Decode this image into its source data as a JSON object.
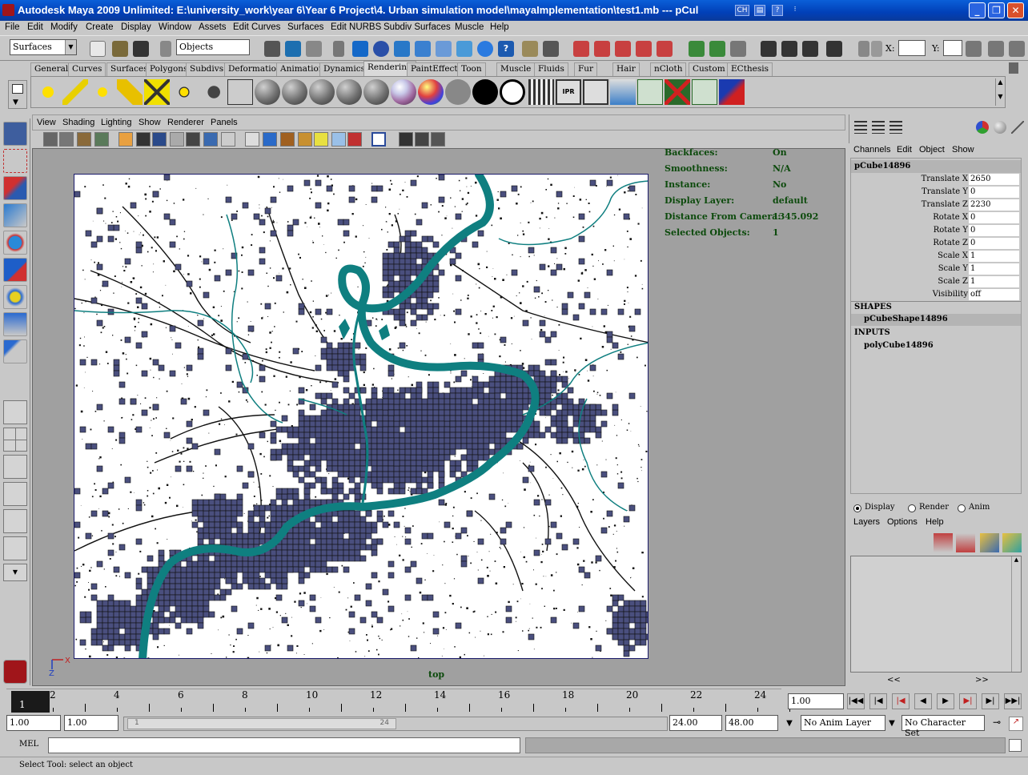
{
  "window": {
    "title": "Autodesk Maya 2009 Unlimited: E:\\university_work\\year 6\\Year 6 Project\\4. Urban simulation model\\mayaImplementation\\test1.mb  ---  pCul",
    "ch_badge": "CH"
  },
  "menubar": [
    "File",
    "Edit",
    "Modify",
    "Create",
    "Display",
    "Window",
    "Assets",
    "Edit Curves",
    "Surfaces",
    "Edit NURBS",
    "Subdiv Surfaces",
    "Muscle",
    "Help"
  ],
  "statusline": {
    "menuset": "Surfaces",
    "selection_mode": "Objects",
    "x_label": "X:",
    "y_label": "Y:"
  },
  "shelf_tabs": [
    "General",
    "Curves",
    "Surfaces",
    "Polygons",
    "Subdivs",
    "Deformation",
    "Animation",
    "Dynamics",
    "Rendering",
    "PaintEffects",
    "Toon",
    "Muscle",
    "Fluids",
    "Fur",
    "Hair",
    "nCloth",
    "Custom",
    "ECthesis"
  ],
  "active_shelf": "Rendering",
  "panel_menu": [
    "View",
    "Shading",
    "Lighting",
    "Show",
    "Renderer",
    "Panels"
  ],
  "hud": [
    {
      "label": "Backfaces:",
      "value": "On"
    },
    {
      "label": "Smoothness:",
      "value": "N/A"
    },
    {
      "label": "Instance:",
      "value": "No"
    },
    {
      "label": "Display Layer:",
      "value": "default"
    },
    {
      "label": "Distance From Camera:",
      "value": "1345.092"
    },
    {
      "label": "Selected Objects:",
      "value": "1"
    }
  ],
  "camera_name": "top",
  "axis": {
    "x": "X",
    "z": "Z"
  },
  "channel_box": {
    "menu": [
      "Channels",
      "Edit",
      "Object",
      "Show"
    ],
    "object": "pCube14896",
    "attributes": [
      {
        "name": "Translate X",
        "value": "2650"
      },
      {
        "name": "Translate Y",
        "value": "0"
      },
      {
        "name": "Translate Z",
        "value": "2230"
      },
      {
        "name": "Rotate X",
        "value": "0"
      },
      {
        "name": "Rotate Y",
        "value": "0"
      },
      {
        "name": "Rotate Z",
        "value": "0"
      },
      {
        "name": "Scale X",
        "value": "1"
      },
      {
        "name": "Scale Y",
        "value": "1"
      },
      {
        "name": "Scale Z",
        "value": "1"
      },
      {
        "name": "Visibility",
        "value": "off"
      }
    ],
    "shapes_header": "SHAPES",
    "shape": "pCubeShape14896",
    "inputs_header": "INPUTS",
    "input": "polyCube14896"
  },
  "layer_editor": {
    "modes": [
      "Display",
      "Render",
      "Anim"
    ],
    "menu": [
      "Layers",
      "Options",
      "Help"
    ],
    "nav_prev": "<<",
    "nav_next": ">>"
  },
  "timeline": {
    "ticks": [
      "2",
      "4",
      "6",
      "8",
      "10",
      "12",
      "14",
      "16",
      "18",
      "20",
      "22",
      "24"
    ],
    "current_frame": "1",
    "current_time": "1.00",
    "start": "1.00",
    "playback_start": "1.00",
    "range_left": "1",
    "range_right": "24",
    "playback_end": "24.00",
    "end": "48.00",
    "anim_layer": "No Anim Layer",
    "character_set": "No Character Set"
  },
  "command_line": {
    "lang": "MEL"
  },
  "help_line": "Select Tool: select an object",
  "colors": {
    "titlebar": "#0a4fd0",
    "viewport_bg": "#a0a0a0",
    "cell_fill": "#4a4f7e",
    "river": "#0f7f80",
    "hud_text": "#0c4a0c"
  }
}
